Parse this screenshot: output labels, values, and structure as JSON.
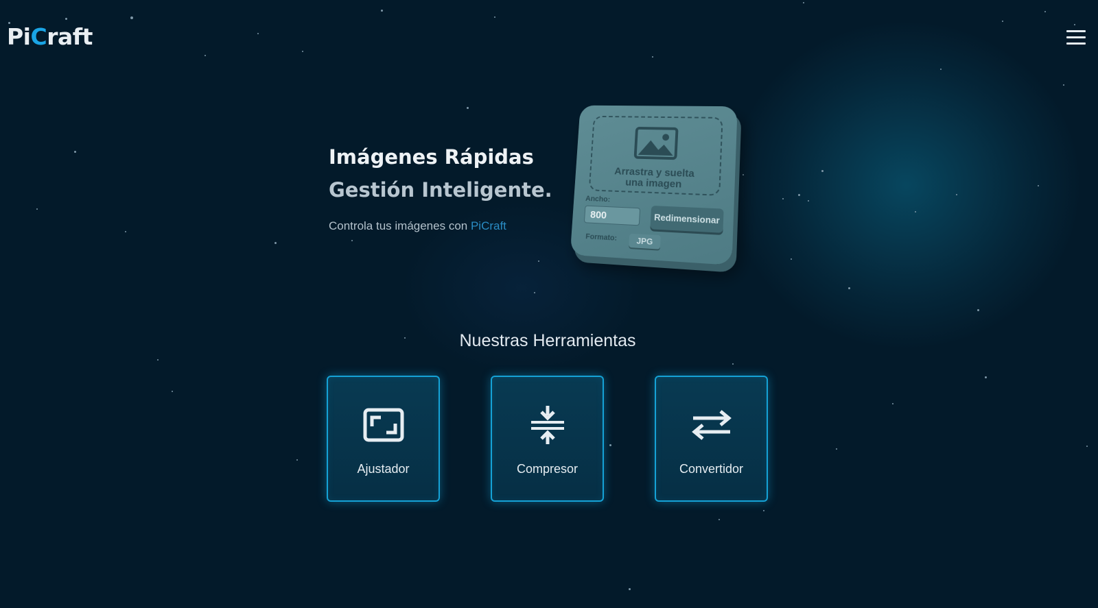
{
  "header": {
    "logo_part1": "Pi",
    "logo_accent": "C",
    "logo_part2": "raft",
    "menu_icon": "hamburger-menu-icon"
  },
  "hero": {
    "title": "Imágenes Rápidas",
    "subtitle": "Gestión Inteligente.",
    "tagline": "Controla tus imágenes con ",
    "tagline_brand": "PiCraft"
  },
  "mockup": {
    "image_icon": "image-placeholder-icon",
    "drop_text_line1": "Arrastra y suelta",
    "drop_text_line2": "una imagen",
    "width_label": "Ancho:",
    "width_value": "800",
    "resize_button": "Redimensionar",
    "format_label": "Formato:",
    "format_value": "JPG"
  },
  "tools": {
    "title": "Nuestras Herramientas",
    "items": [
      {
        "label": "Ajustador",
        "icon": "resize-frame-icon"
      },
      {
        "label": "Compresor",
        "icon": "compress-icon"
      },
      {
        "label": "Convertidor",
        "icon": "swap-arrows-icon"
      }
    ]
  },
  "colors": {
    "background": "#031a2a",
    "accent": "#1aa5e6",
    "card_border": "#15a2d6",
    "card_background": "#083a52"
  }
}
